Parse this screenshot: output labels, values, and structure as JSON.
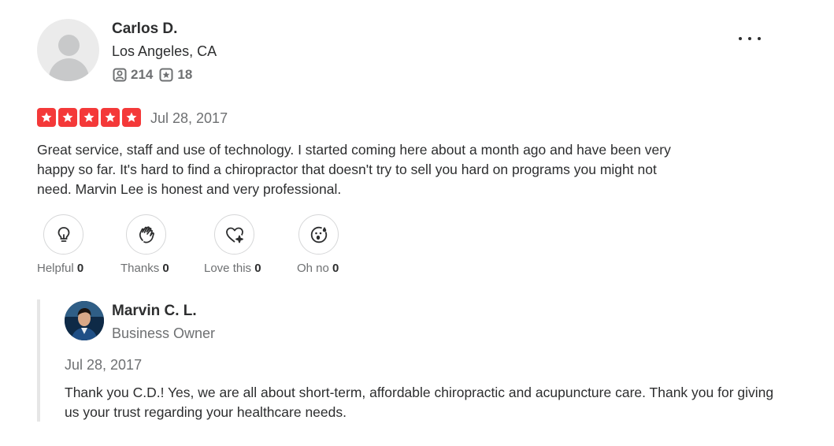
{
  "reviewer": {
    "name": "Carlos D.",
    "location": "Los Angeles, CA",
    "friends_count": "214",
    "reviews_count": "18"
  },
  "review": {
    "rating": 5,
    "rating_color": "#f43939",
    "date": "Jul 28, 2017",
    "text": "Great service, staff and use of technology. I started coming here about a month ago and have been very happy so far. It's hard to find a chiropractor that doesn't try to sell you hard on programs you might not need. Marvin Lee is honest and very professional."
  },
  "reactions": [
    {
      "label": "Helpful",
      "count": "0",
      "icon": "lightbulb-icon"
    },
    {
      "label": "Thanks",
      "count": "0",
      "icon": "clapping-hands-icon"
    },
    {
      "label": "Love this",
      "count": "0",
      "icon": "heart-sparkle-icon"
    },
    {
      "label": "Oh no",
      "count": "0",
      "icon": "surprised-face-icon"
    }
  ],
  "reply": {
    "owner_name": "Marvin C. L.",
    "owner_role": "Business Owner",
    "date": "Jul 28, 2017",
    "text": "Thank you C.D.! Yes, we are all about short-term, affordable chiropractic and acupuncture care. Thank you for giving us your trust regarding your healthcare needs."
  }
}
